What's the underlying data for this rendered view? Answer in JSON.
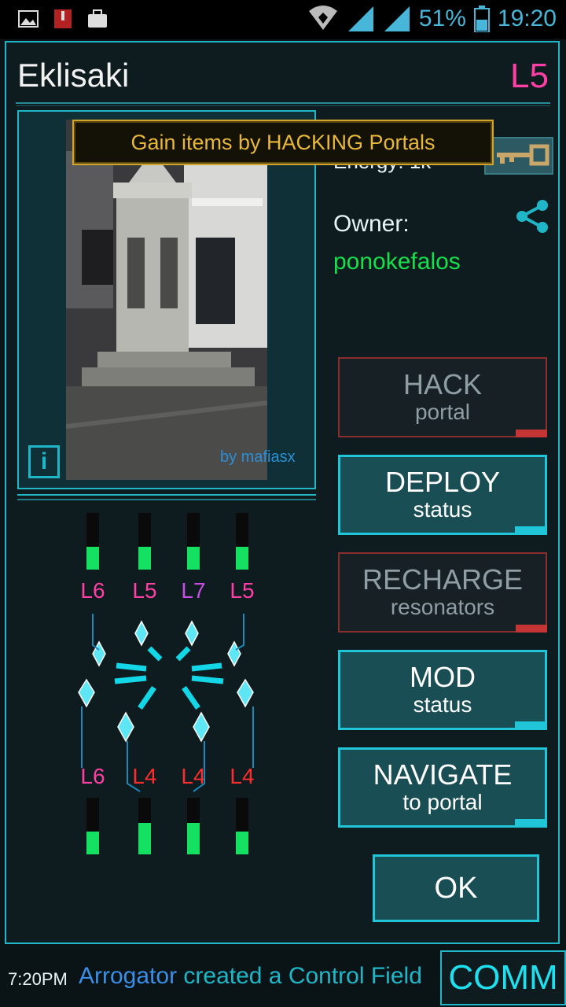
{
  "status_bar": {
    "battery": "51%",
    "time": "19:20",
    "icons": [
      "image-icon",
      "archive-icon",
      "briefcase-icon",
      "wifi-icon",
      "signal-icon",
      "signal-icon",
      "battery-icon"
    ]
  },
  "portal": {
    "name": "Eklisaki",
    "level": "L5",
    "energy_label": "Energy: 1k",
    "photo_credit": "by mafiasx",
    "owner_label": "Owner:",
    "owner_name": "ponokefalos"
  },
  "tooltip": "Gain items by HACKING Portals",
  "actions": [
    {
      "title": "HACK",
      "sub": "portal",
      "enabled": false
    },
    {
      "title": "DEPLOY",
      "sub": "status",
      "enabled": true
    },
    {
      "title": "RECHARGE",
      "sub": "resonators",
      "enabled": false
    },
    {
      "title": "MOD",
      "sub": "status",
      "enabled": true
    },
    {
      "title": "NAVIGATE",
      "sub": "to portal",
      "enabled": true
    }
  ],
  "ok_label": "OK",
  "resonators": {
    "top": [
      {
        "level": "L6",
        "color": "#ff3fa4",
        "charge": 0.4
      },
      {
        "level": "L5",
        "color": "#ff3fa4",
        "charge": 0.4
      },
      {
        "level": "L7",
        "color": "#c74ee6",
        "charge": 0.4
      },
      {
        "level": "L5",
        "color": "#ff3fa4",
        "charge": 0.4
      }
    ],
    "bottom": [
      {
        "level": "L6",
        "color": "#ff3fa4",
        "charge": 0.4
      },
      {
        "level": "L4",
        "color": "#ff2d2d",
        "charge": 0.55
      },
      {
        "level": "L4",
        "color": "#ff2d2d",
        "charge": 0.55
      },
      {
        "level": "L4",
        "color": "#ff2d2d",
        "charge": 0.4
      }
    ]
  },
  "comm": {
    "time": "7:20PM",
    "agent": "Arrogator",
    "message": " created a Control Field",
    "button": "COMM"
  }
}
